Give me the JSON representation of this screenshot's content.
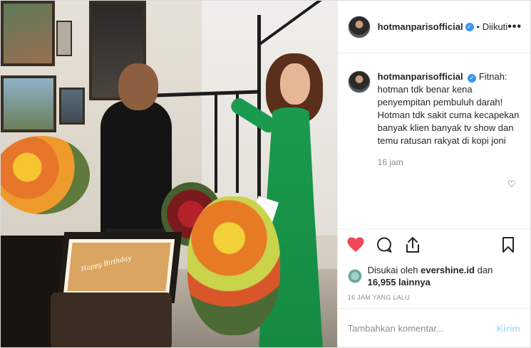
{
  "photo": {
    "cake_text": "Happy Birthday"
  },
  "header": {
    "username": "hotmanparisofficial",
    "verified_icon": "verified-badge-icon",
    "separator": "•",
    "follow_status": "Diikuti",
    "more_icon": "more-options-icon",
    "more_label": "•••"
  },
  "caption": {
    "username": "hotmanparisofficial",
    "text": "Fitnah: hotman tdk benar kena penyempitan pembuluh darah! Hotman tdk sakit cuma kecapekan banyak klien banyak tv show dan temu ratusan rakyat di kopi joni",
    "time": "16 jam"
  },
  "actions": {
    "like_icon": "heart-filled-icon",
    "comment_icon": "comment-icon",
    "share_icon": "share-icon",
    "save_icon": "bookmark-icon",
    "like_color": "#ed4956"
  },
  "likes": {
    "prefix": "Disukai oleh",
    "user": "evershine.id",
    "middle": "dan",
    "count": "16,955",
    "suffix": "lainnya"
  },
  "timestamp": "16 JAM YANG LALU",
  "comment_box": {
    "placeholder": "Tambahkan komentar...",
    "post_label": "Kirim"
  }
}
